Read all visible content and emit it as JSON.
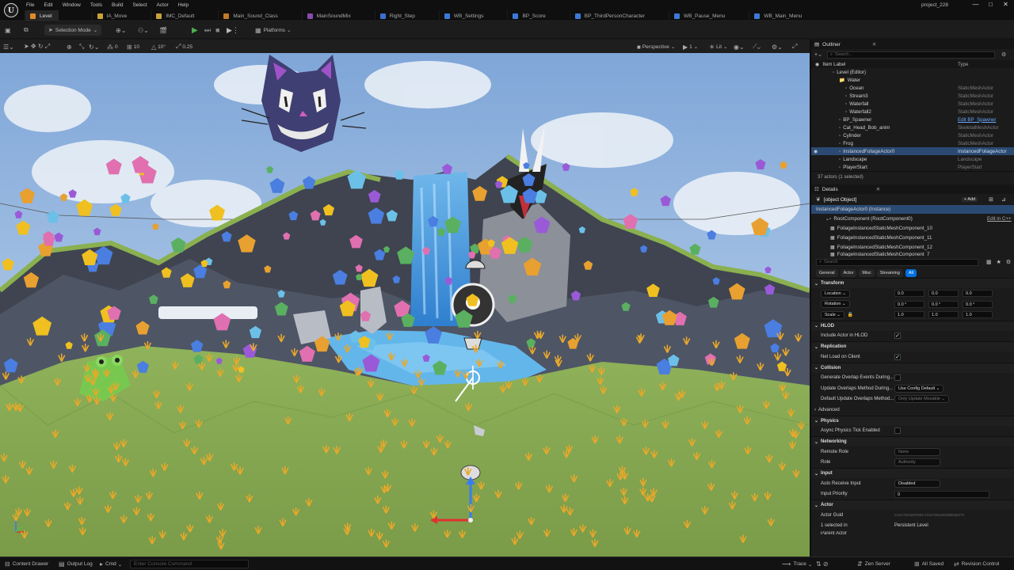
{
  "app": {
    "logo": "U",
    "project": "project_228",
    "window_controls": [
      "—",
      "□",
      "✕"
    ]
  },
  "menu": [
    "File",
    "Edit",
    "Window",
    "Tools",
    "Build",
    "Select",
    "Actor",
    "Help"
  ],
  "tabs": [
    {
      "label": "Level",
      "color": "#e08a2a"
    },
    {
      "label": "IA_Move",
      "color": "#c9a13a"
    },
    {
      "label": "IMC_Default",
      "color": "#c9a13a"
    },
    {
      "label": "Main_Sound_Class",
      "color": "#c07a2a"
    },
    {
      "label": "MainSoundMix",
      "color": "#8a4ab0"
    },
    {
      "label": "Right_Step",
      "color": "#3b6fd0"
    },
    {
      "label": "WB_Settings",
      "color": "#3b7ad8"
    },
    {
      "label": "BP_Score",
      "color": "#3b7ad8"
    },
    {
      "label": "BP_ThirdPersonCharacter",
      "color": "#3b7ad8"
    },
    {
      "label": "WB_Pause_Menu",
      "color": "#3b7ad8"
    },
    {
      "label": "WB_Main_Menu",
      "color": "#3b7ad8"
    }
  ],
  "toolbar": {
    "selection_mode": "Selection Mode",
    "platforms": "Platforms"
  },
  "viewport_bar": {
    "perspective": "Perspective",
    "lit": "Lit",
    "grid_snap": "10",
    "rot_snap": "10°",
    "scale_snap": "0.25",
    "cam_speed": "1",
    "zero": "0"
  },
  "outliner": {
    "title": "Outliner",
    "search_placeholder": "Search...",
    "col_label": "Item Label",
    "col_type": "Type",
    "items": [
      {
        "label": "Level (Editor)",
        "type": "",
        "indent": 14
      },
      {
        "label": "Water",
        "type": "",
        "indent": 22
      },
      {
        "label": "Ocean",
        "type": "StaticMeshActor",
        "indent": 30
      },
      {
        "label": "Stream3",
        "type": "StaticMeshActor",
        "indent": 30
      },
      {
        "label": "Waterfall",
        "type": "StaticMeshActor",
        "indent": 30
      },
      {
        "label": "Waterfall2",
        "type": "StaticMeshActor",
        "indent": 30
      },
      {
        "label": "BP_Spawner",
        "type": "Edit BP_Spawner",
        "indent": 22
      },
      {
        "label": "Cat_Head_Bob_anim",
        "type": "SkeletalMeshActor",
        "indent": 22
      },
      {
        "label": "Cylinder",
        "type": "StaticMeshActor",
        "indent": 22
      },
      {
        "label": "Frog",
        "type": "StaticMeshActor",
        "indent": 22
      },
      {
        "label": "InstancedFoliageActor0",
        "type": "InstancedFoliageActor",
        "indent": 22,
        "selected": true
      },
      {
        "label": "Landscape",
        "type": "Landscape",
        "indent": 22
      },
      {
        "label": "PlayerStart",
        "type": "PlayerStart",
        "indent": 22
      }
    ],
    "footer": "37 actors (1 selected)"
  },
  "details": {
    "title": "Details",
    "actor": {
      "section": "Actor",
      "guid": "Actor Guid",
      "guid_val": "C12A7DCB4FDEC71017052462DDE3E073",
      "selected": "1 selected in",
      "selected_val": "Persistent Level",
      "parent": "Parent Actor"
    },
    "add": "+ Add",
    "instance": "InstancedFoliageActor0 (Instance)",
    "root": "RootComponent (RootComponent0)",
    "edit_cpp": "Edit in C++",
    "components": [
      "FoliageInstancedStaticMeshComponent_10",
      "FoliageInstancedStaticMeshComponent_11",
      "FoliageInstancedStaticMeshComponent_12",
      "FoliageInstancedStaticMeshComponent_7"
    ],
    "search_placeholder": "Search",
    "filters": [
      "General",
      "Actor",
      "Misc",
      "Streaming",
      "All"
    ],
    "transform": {
      "section": "Transform",
      "location": "Location",
      "rotation": "Rotation",
      "scale": "Scale",
      "loc": [
        "0.0",
        "0.0",
        "0.0"
      ],
      "rot": [
        "0.0 °",
        "0.0 °",
        "0.0 °"
      ],
      "scl": [
        "1.0",
        "1.0",
        "1.0"
      ]
    },
    "hlod": {
      "section": "HLOD",
      "include": "Include Actor in HLOD"
    },
    "replication": {
      "section": "Replication",
      "net_load": "Net Load on Client"
    },
    "collision": {
      "section": "Collision",
      "gen_overlap": "Generate Overlap Events During...",
      "update_overlap": "Update Overlaps Method During...",
      "update_val": "Use Config Default",
      "default_overlap": "Default Update Overlaps Method...",
      "default_val": "Only Update Movable"
    },
    "advanced": "Advanced",
    "physics": {
      "section": "Physics",
      "async": "Async Physics Tick Enabled"
    },
    "networking": {
      "section": "Networking",
      "remote_role": "Remote Role",
      "remote_val": "None",
      "role": "Role",
      "role_val": "Authority"
    },
    "input": {
      "section": "Input",
      "auto_receive": "Auto Receive Input",
      "auto_val": "Disabled",
      "priority": "Input Priority",
      "priority_val": "0"
    }
  },
  "status": {
    "content_drawer": "Content Drawer",
    "output_log": "Output Log",
    "cmd": "Cmd",
    "console_placeholder": "Enter Console Command",
    "trace": "Trace",
    "zen": "Zen Server",
    "all_saved": "All Saved",
    "revision": "Revision Control"
  },
  "colors": {
    "accent": "#0070e0",
    "selection": "#2b4a73",
    "sky": "#a9c6e6",
    "grass": "#7fa050"
  }
}
